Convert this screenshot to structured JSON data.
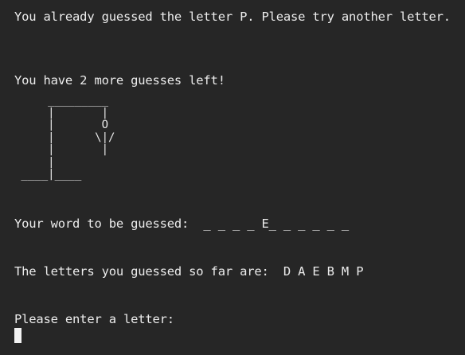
{
  "terminal": {
    "lines": {
      "already_guessed": "You already guessed the letter P. Please try another letter.",
      "guesses_left": "You have 2 more guesses left!",
      "word_prompt": "Your word to be guessed:  _ _ _ _ E_ _ _ _ _ _",
      "letters_guessed": "The letters you guessed so far are:  D A E B M P",
      "enter_letter": "Please enter a letter:"
    },
    "hangman_art": "     _________\n     |       |\n     |       O\n     |      \\|/\n     |       |\n     |\n ____|____"
  }
}
